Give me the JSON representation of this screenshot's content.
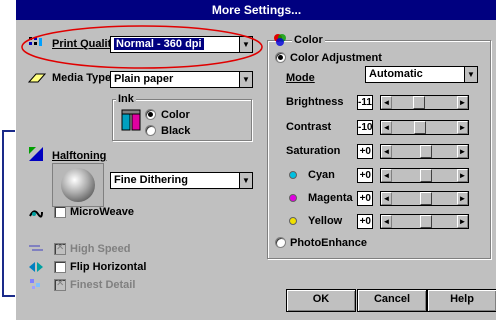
{
  "window": {
    "title": "More Settings..."
  },
  "print_quality": {
    "label": "Print Quality",
    "value": "Normal - 360 dpi"
  },
  "media_type": {
    "label": "Media Type",
    "value": "Plain paper"
  },
  "ink": {
    "label": "Ink",
    "options": [
      "Color",
      "Black"
    ],
    "selected": "Color"
  },
  "halftoning": {
    "label": "Halftoning",
    "value": "Fine Dithering"
  },
  "checkboxes": {
    "microweave": "MicroWeave",
    "high_speed": "High Speed",
    "flip_horizontal": "Flip Horizontal",
    "finest_detail": "Finest Detail"
  },
  "color": {
    "label": "Color",
    "adjustment_label": "Color Adjustment",
    "mode_label": "Mode",
    "mode_value": "Automatic",
    "sliders": [
      {
        "label": "Brightness",
        "value": "-11",
        "level": 0.4
      },
      {
        "label": "Contrast",
        "value": "-10",
        "level": 0.42
      },
      {
        "label": "Saturation",
        "value": "+0",
        "level": 0.52
      },
      {
        "label": "Cyan",
        "value": "+0",
        "level": 0.52,
        "dot": "#00c0e0"
      },
      {
        "label": "Magenta",
        "value": "+0",
        "level": 0.52,
        "dot": "#e000e0"
      },
      {
        "label": "Yellow",
        "value": "+0",
        "level": 0.52,
        "dot": "#f0e000"
      }
    ],
    "photoenhance_label": "PhotoEnhance"
  },
  "buttons": {
    "ok": "OK",
    "cancel": "Cancel",
    "help": "Help"
  },
  "colors": {
    "title_bar": "#000080",
    "highlight_ellipse": "#e00000",
    "bracket": "#1a2a8a"
  }
}
